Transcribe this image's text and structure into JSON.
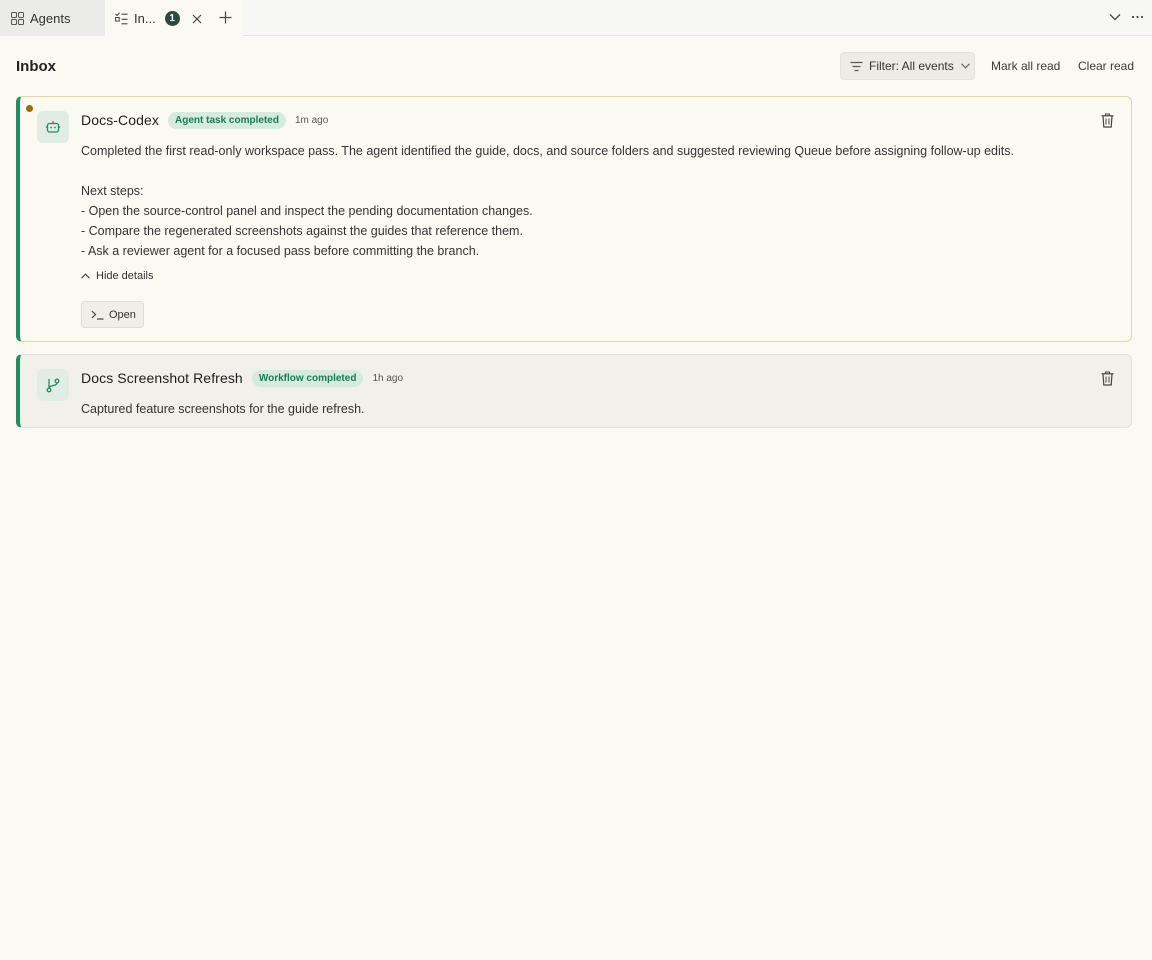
{
  "tabs": {
    "agents_label": "Agents",
    "inbox_label": "In...",
    "inbox_badge": "1"
  },
  "header": {
    "title": "Inbox",
    "filter_label": "Filter: All events",
    "mark_all_read": "Mark all read",
    "clear_read": "Clear read"
  },
  "cards": [
    {
      "title": "Docs-Codex",
      "badge": "Agent task completed",
      "time": "1m ago",
      "unread": true,
      "icon": "robot-icon",
      "body": [
        "Completed the first read-only workspace pass. The agent identified the guide, docs, and source folders and suggested reviewing Queue before assigning follow-up edits.",
        "",
        "Next steps:",
        "- Open the source-control panel and inspect the pending documentation changes.",
        "- Compare the regenerated screenshots against the guides that reference them.",
        "- Ask a reviewer agent for a focused pass before committing the branch."
      ],
      "hide_details": "Hide details",
      "open_label": "Open"
    },
    {
      "title": "Docs Screenshot Refresh",
      "badge": "Workflow completed",
      "time": "1h ago",
      "unread": false,
      "icon": "workflow-branch-icon",
      "body": [
        "Captured feature screenshots for the guide refresh."
      ]
    }
  ],
  "colors": {
    "accent": "#1f8f5f",
    "badge_bg": "#d5ebdc",
    "unread_dot": "#9a6b10",
    "background": "#faf9f4"
  }
}
